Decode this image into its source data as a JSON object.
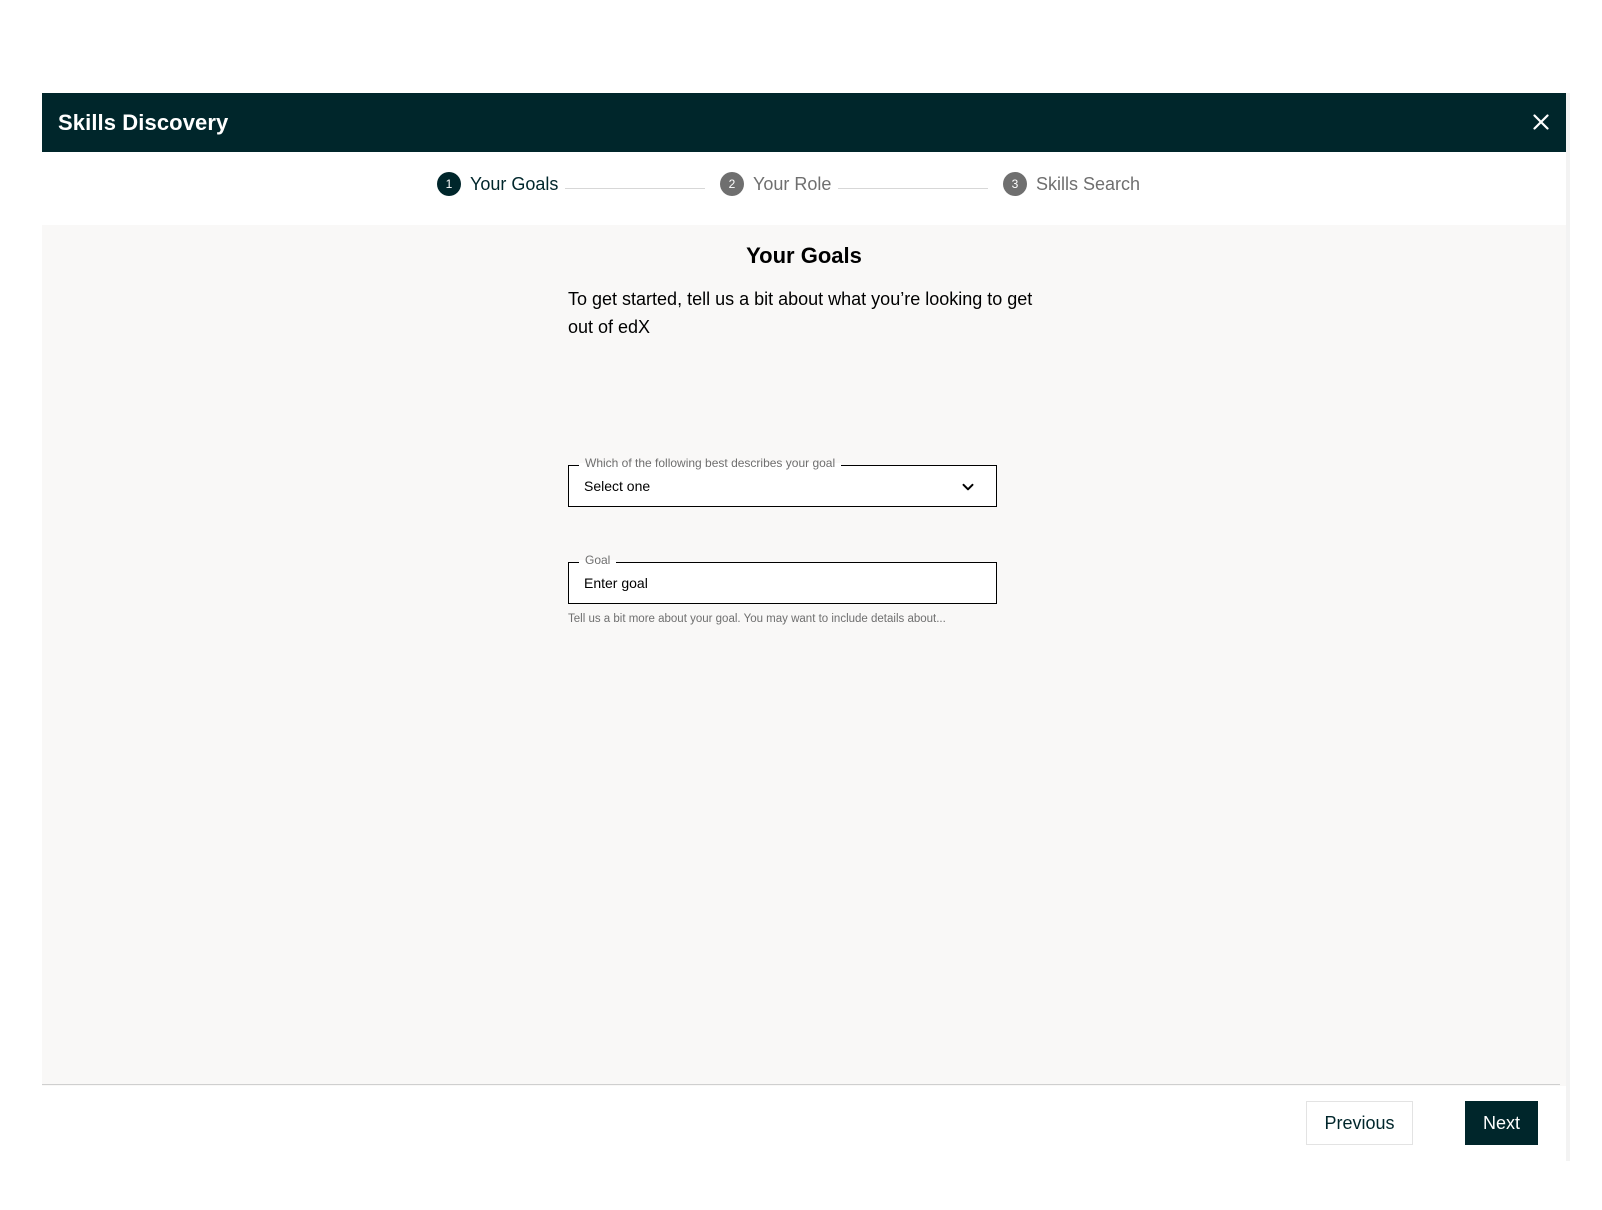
{
  "modal": {
    "title": "Skills Discovery",
    "close_icon": "close-icon"
  },
  "stepper": {
    "steps": [
      {
        "number": "1",
        "label": "Your Goals",
        "active": true
      },
      {
        "number": "2",
        "label": "Your Role",
        "active": false
      },
      {
        "number": "3",
        "label": "Skills Search",
        "active": false
      }
    ]
  },
  "main": {
    "title": "Your Goals",
    "intro": "To get started, tell us a bit about what you’re looking to get out of edX",
    "goal_select": {
      "label": "Which of the following best describes your goal",
      "value": "Select one",
      "icon": "chevron-down-icon"
    },
    "goal_input": {
      "label": "Goal",
      "placeholder": "Enter goal",
      "help": "Tell us a bit more about your goal. You may want to include details about..."
    }
  },
  "footer": {
    "previous_label": "Previous",
    "next_label": "Next"
  },
  "colors": {
    "brand_dark": "#00262b",
    "inactive_gray": "#6f6f6f",
    "body_bg": "#f9f8f7"
  }
}
